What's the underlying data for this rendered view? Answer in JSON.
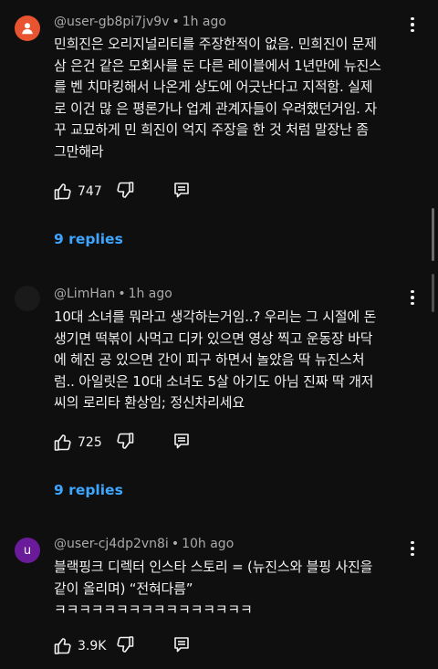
{
  "comments": [
    {
      "author": "@user-gb8pi7jv9v",
      "separator": "•",
      "time": "1h ago",
      "avatar_letter": "",
      "avatar_color": "#e8542f",
      "avatar_icon": "user-icon",
      "text": "민희진은 오리지널리티를 주장한적이 없음. 민희진이 문제\n삼 은건 같은 모회사를 둔 다른 레이블에서 1년만에 뉴진스\n를 벤 치마킹해서 나온게 상도에 어긋난다고 지적함. 실제\n로 이건 많 은 평론가나 업계 관계자들이 우려했던거임. 자\n꾸 교묘하게 민 희진이 억지 주장을 한 것 처럼 말장난 좀\n그만해라",
      "likes": "747",
      "replies_label": "9 replies"
    },
    {
      "author": "@LimHan",
      "separator": "•",
      "time": "1h ago",
      "avatar_letter": "",
      "avatar_color": "#1a1a1a",
      "avatar_icon": "dark-avatar",
      "text": "10대 소녀를 뭐라고 생각하는거임..? 우리는 그 시절에 돈\n생기면 떡볶이 사먹고 디카 있으면 영상 찍고 운동장 바닥\n에 헤진 공 있으면 간이 피구 하면서 놀았음 딱 뉴진스처\n럼.. 아일릿은 10대 소녀도 5살 아기도 아님 진짜 딱 개저\n씨의 로리타 환상임; 정신차리세요",
      "likes": "725",
      "replies_label": "9 replies"
    },
    {
      "author": "@user-cj4dp2vn8i",
      "separator": "•",
      "time": "10h ago",
      "avatar_letter": "u",
      "avatar_color": "#6a1b9a",
      "avatar_icon": "",
      "text": "블랙핑크 디렉터 인스타 스토리 = (뉴진스와 블핑 사진을\n같이 올리며) “전혀다름”\nㅋㅋㅋㅋㅋㅋㅋㅋㅋㅋㅋㅋㅋㅋㅋㅋ",
      "likes": "3.9K",
      "replies_label": ""
    }
  ],
  "colors": {
    "background": "#0f0f0f",
    "text": "#f1f1f1",
    "meta": "#aaaaaa",
    "link": "#3ea6ff"
  },
  "icons": {
    "like": "thumbs-up-icon",
    "dislike": "thumbs-down-icon",
    "reply": "reply-icon",
    "menu": "more-vertical-icon"
  }
}
